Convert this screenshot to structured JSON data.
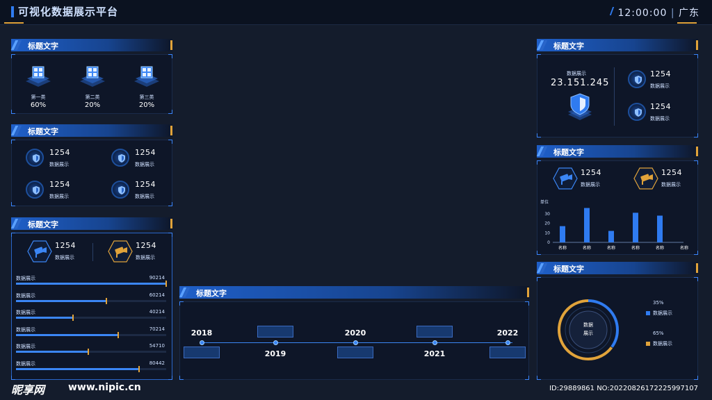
{
  "header": {
    "title": "可视化数据展示平台",
    "time": "12:00:00",
    "region": "广东"
  },
  "panel_title": "标题文字",
  "p1": {
    "items": [
      {
        "label": "第一类",
        "value": "60%"
      },
      {
        "label": "第二类",
        "value": "20%"
      },
      {
        "label": "第三类",
        "value": "20%"
      }
    ]
  },
  "p2": {
    "items": [
      {
        "num": "1254",
        "label": "数据展示"
      },
      {
        "num": "1254",
        "label": "数据展示"
      },
      {
        "num": "1254",
        "label": "数据展示"
      },
      {
        "num": "1254",
        "label": "数据展示"
      }
    ]
  },
  "p3": {
    "cams": [
      {
        "num": "1254",
        "label": "数据展示"
      },
      {
        "num": "1254",
        "label": "数据展示"
      }
    ],
    "bars": [
      {
        "label": "数据展示",
        "value": "90214",
        "pct": 1.0
      },
      {
        "label": "数据展示",
        "value": "60214",
        "pct": 0.6
      },
      {
        "label": "数据展示",
        "value": "40214",
        "pct": 0.38
      },
      {
        "label": "数据展示",
        "value": "70214",
        "pct": 0.68
      },
      {
        "label": "数据展示",
        "value": "54710",
        "pct": 0.48
      },
      {
        "label": "数据展示",
        "value": "80442",
        "pct": 0.82
      }
    ]
  },
  "timeline": {
    "years": [
      "2018",
      "2019",
      "2020",
      "2021",
      "2022"
    ]
  },
  "r1": {
    "label": "数据展示",
    "big": "23.151.245",
    "items": [
      {
        "num": "1254",
        "label": "数据展示"
      },
      {
        "num": "1254",
        "label": "数据展示"
      }
    ]
  },
  "r2": {
    "cams": [
      {
        "num": "1254",
        "label": "数据展示"
      },
      {
        "num": "1254",
        "label": "数据展示"
      }
    ]
  },
  "chart_data": {
    "type": "bar",
    "ylabel": "单位",
    "categories": [
      "名称",
      "名称",
      "名称",
      "名称",
      "名称",
      "名称"
    ],
    "values": [
      17,
      36,
      12,
      31,
      28
    ],
    "ylim": [
      0,
      40
    ],
    "yticks": [
      "0",
      "10",
      "20",
      "30"
    ],
    "grid": false
  },
  "r3": {
    "center": "数据\n展示",
    "legend": [
      {
        "pct": "35%",
        "label": "数据展示",
        "color": "#2f7bf0"
      },
      {
        "pct": "65%",
        "label": "数据展示",
        "color": "#e1a33a"
      }
    ]
  },
  "watermark": {
    "brand": "昵享网",
    "site": "www.nipic.cn",
    "id": "ID:29889861 NO:20220826172225997107"
  }
}
